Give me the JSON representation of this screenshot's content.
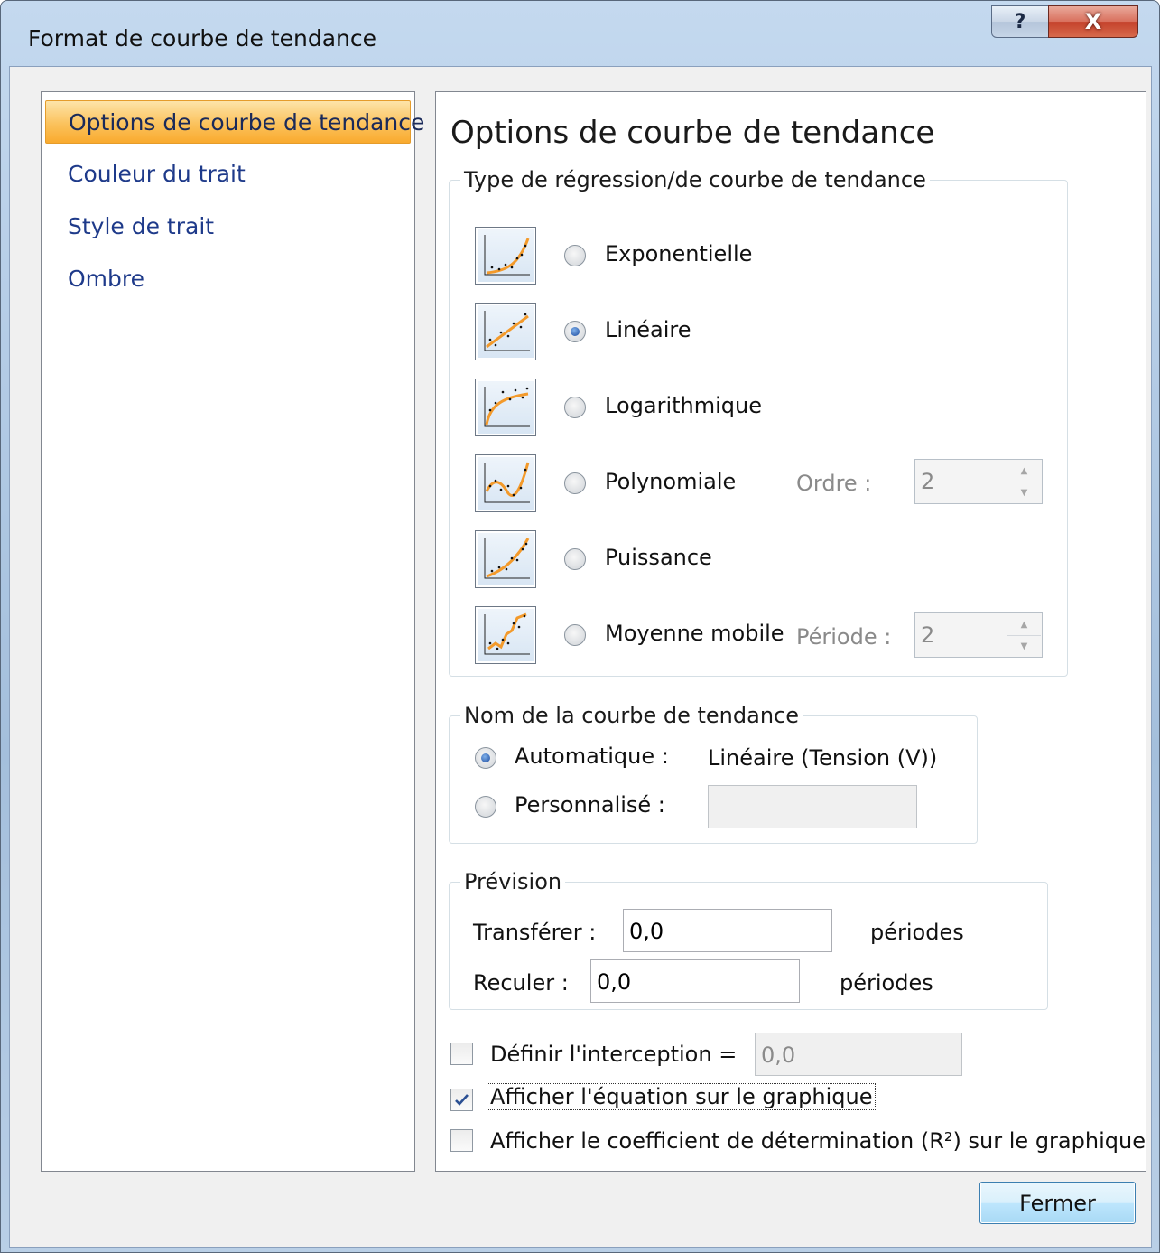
{
  "window": {
    "title": "Format de courbe de tendance"
  },
  "titlebar": {
    "help_glyph": "?",
    "close_glyph": "X"
  },
  "nav": {
    "items": [
      {
        "label": "Options de courbe de tendance",
        "selected": true
      },
      {
        "label": "Couleur du trait",
        "selected": false
      },
      {
        "label": "Style de trait",
        "selected": false
      },
      {
        "label": "Ombre",
        "selected": false
      }
    ]
  },
  "main": {
    "heading": "Options de courbe de tendance"
  },
  "regression": {
    "legend": "Type de régression/de courbe de tendance",
    "types": [
      {
        "label": "Exponentielle",
        "checked": false,
        "icon": "exponential-trend-icon"
      },
      {
        "label": "Linéaire",
        "checked": true,
        "icon": "linear-trend-icon"
      },
      {
        "label": "Logarithmique",
        "checked": false,
        "icon": "logarithmic-trend-icon"
      },
      {
        "label": "Polynomiale",
        "checked": false,
        "icon": "polynomial-trend-icon"
      },
      {
        "label": "Puissance",
        "checked": false,
        "icon": "power-trend-icon"
      },
      {
        "label": "Moyenne mobile",
        "checked": false,
        "icon": "moving-average-icon"
      }
    ],
    "order_label": "Ordre :",
    "order_value": "2",
    "period_label": "Période :",
    "period_value": "2"
  },
  "name": {
    "legend": "Nom de la courbe de tendance",
    "auto_label": "Automatique :",
    "auto_value": "Linéaire (Tension (V))",
    "custom_label": "Personnalisé :",
    "custom_value": "",
    "auto_checked": true
  },
  "forecast": {
    "legend": "Prévision",
    "forward_label": "Transférer :",
    "forward_value": "0,0",
    "backward_label": "Reculer :",
    "backward_value": "0,0",
    "unit": "périodes"
  },
  "options": {
    "intercept_label": "Définir l'interception =",
    "intercept_value": "0,0",
    "intercept_checked": false,
    "equation_label": "Afficher l'équation sur le graphique",
    "equation_checked": true,
    "r2_label": "Afficher le coefficient de détermination (R²) sur le graphique",
    "r2_checked": false
  },
  "buttons": {
    "close_label": "Fermer"
  },
  "colors": {
    "accent_selected": "#fbc25c",
    "nav_text": "#1e3a8a",
    "close_button": "#c4412b"
  }
}
